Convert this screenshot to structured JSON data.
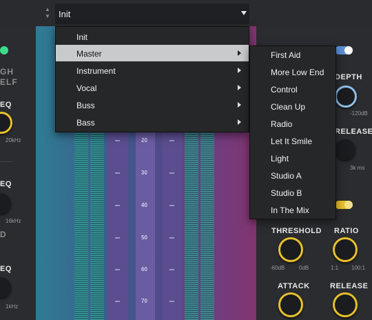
{
  "preset": {
    "value": "Init"
  },
  "left_panel": {
    "high_shelf_label_1": "GH",
    "high_shelf_label_2": "ELF",
    "freq_label_1": "EQ",
    "freq_max_1": "20kHz",
    "freq_label_2": "EQ",
    "freq_max_2": "16kHz",
    "section_label": "D",
    "freq_label_3": "EQ",
    "freq_max_3": "1kHz",
    "colors": {
      "led": "#3ddc8a"
    }
  },
  "display": {
    "scale_ticks": [
      "20",
      "30",
      "40",
      "50",
      "60",
      "70"
    ]
  },
  "right_panel": {
    "depth_label": "DEPTH",
    "depth_min": "-120dB",
    "release_label_top": "RELEASE",
    "release_max_top": "3k ms",
    "threshold_label": "THRESHOLD",
    "threshold_min": "-60dB",
    "threshold_max": "0dB",
    "ratio_label": "RATIO",
    "ratio_min": "1:1",
    "ratio_max": "100:1",
    "attack_label": "ATTACK",
    "release_label_bottom": "RELEASE",
    "colors": {
      "toggle_blue": "#5b8fd8",
      "toggle_yellow": "#e7c12a"
    }
  },
  "menu": {
    "items": [
      {
        "label": "Init",
        "has_submenu": false
      },
      {
        "label": "Master",
        "has_submenu": true
      },
      {
        "label": "Instrument",
        "has_submenu": true
      },
      {
        "label": "Vocal",
        "has_submenu": true
      },
      {
        "label": "Buss",
        "has_submenu": true
      },
      {
        "label": "Bass",
        "has_submenu": true
      }
    ],
    "highlighted": "Master"
  },
  "submenu": {
    "items": [
      "First Aid",
      "More Low End",
      "Control",
      "Clean Up",
      "Radio",
      "Let It Smile",
      "Light",
      "Studio A",
      "Studio B",
      "In The Mix"
    ]
  }
}
